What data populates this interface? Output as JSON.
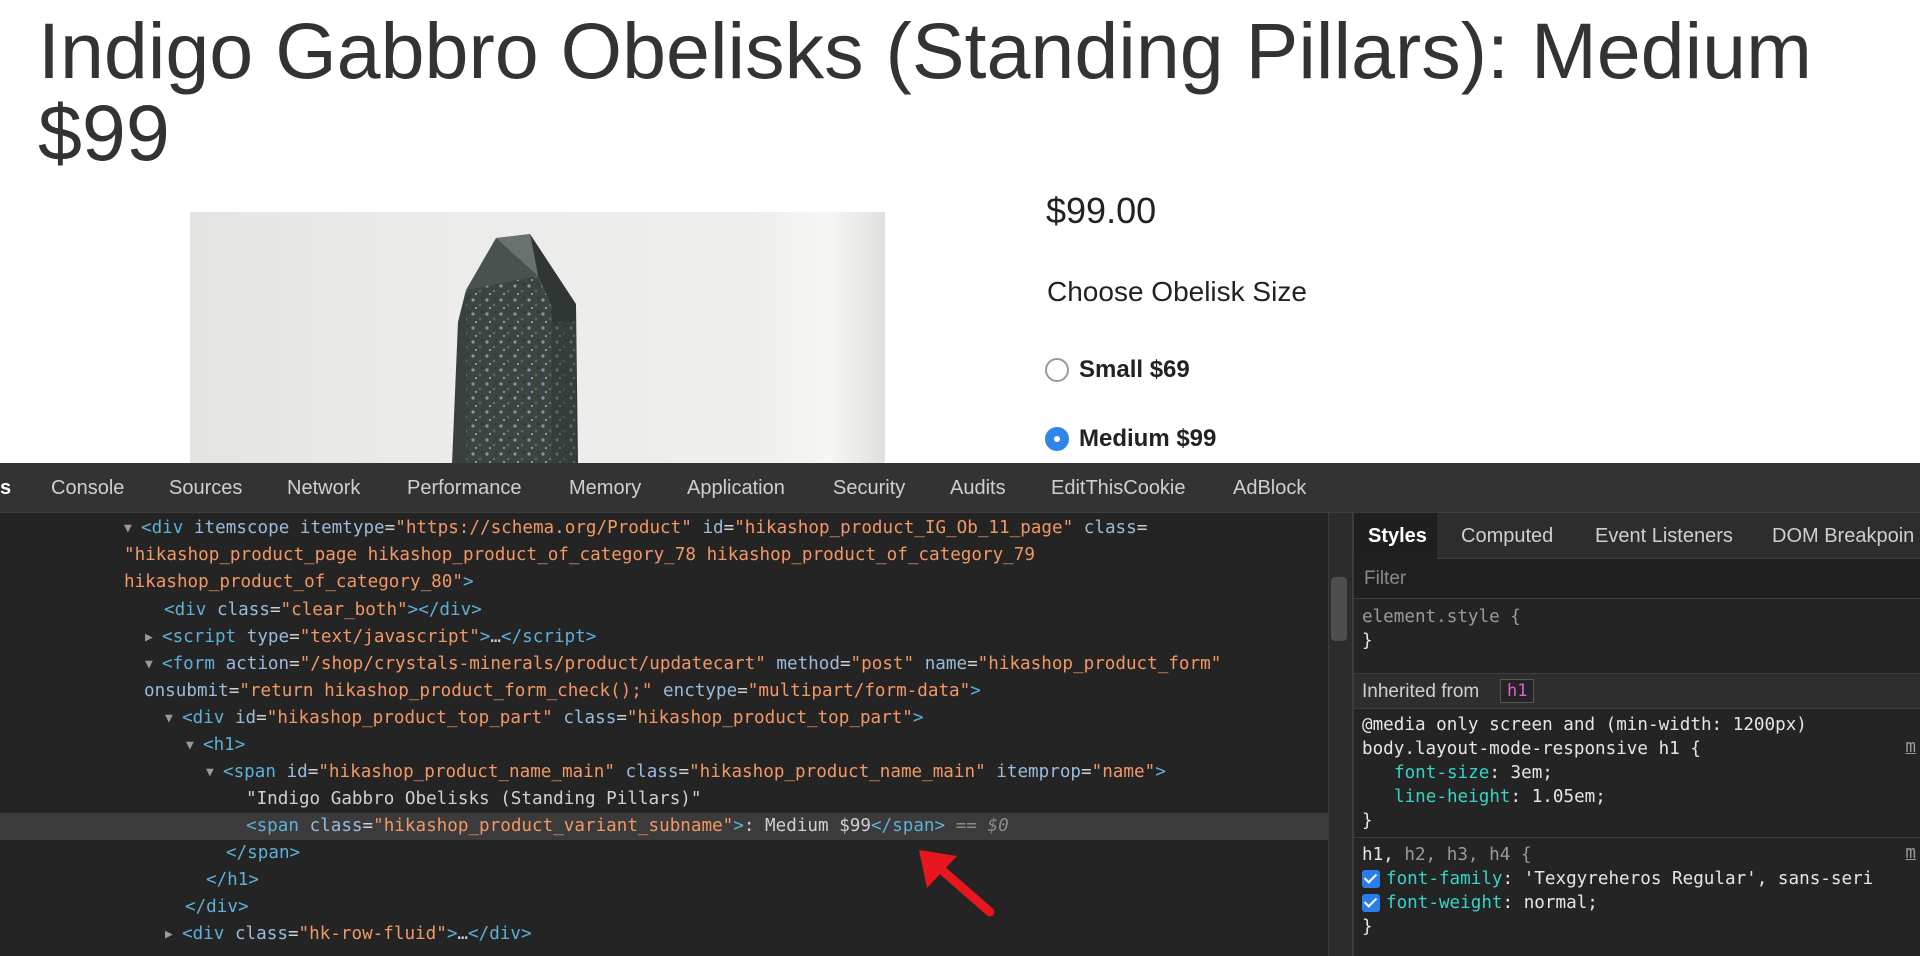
{
  "product": {
    "title": "Indigo Gabbro Obelisks (Standing Pillars): Medium $99",
    "price": "$99.00",
    "option_heading": "Choose Obelisk Size",
    "options": [
      {
        "label": "Small $69",
        "selected": false
      },
      {
        "label": "Medium $99",
        "selected": true
      }
    ]
  },
  "devtools": {
    "tabs": [
      "s",
      "Console",
      "Sources",
      "Network",
      "Performance",
      "Memory",
      "Application",
      "Security",
      "Audits",
      "EditThisCookie",
      "AdBlock"
    ],
    "active_tab": "s",
    "dom": {
      "l1": {
        "tag_open": "<div",
        "a1": "itemscope",
        "a2": "itemtype",
        "v2": "\"https://schema.org/Product\"",
        "a3": "id",
        "v3": "\"hikashop_product_IG_Ob_11_page\"",
        "a4": "class"
      },
      "l2": "\"hikashop_product_page hikashop_product_of_category_78 hikashop_product_of_category_79",
      "l3": "hikashop_product_of_category_80\"",
      "l4": {
        "tag": "div",
        "attr": "class",
        "value": "\"clear_both\""
      },
      "l5": {
        "tag": "script",
        "attr": "type",
        "value": "\"text/javascript\""
      },
      "l6": {
        "tag": "form",
        "a1": "action",
        "v1": "\"/shop/crystals-minerals/product/updatecart\"",
        "a2": "method",
        "v2": "\"post\"",
        "a3": "name",
        "v3": "\"hikashop_product_form\""
      },
      "l7": {
        "a1": "onsubmit",
        "v1": "\"return hikashop_product_form_check();\"",
        "a2": "enctype",
        "v2": "\"multipart/form-data\""
      },
      "l8": {
        "tag": "div",
        "a1": "id",
        "v1": "\"hikashop_product_top_part\"",
        "a2": "class",
        "v2": "\"hikashop_product_top_part\""
      },
      "l9": {
        "tag": "h1"
      },
      "l10": {
        "tag": "span",
        "a1": "id",
        "v1": "\"hikashop_product_name_main\"",
        "a2": "class",
        "v2": "\"hikashop_product_name_main\"",
        "a3": "itemprop",
        "v3": "\"name\""
      },
      "l11": "\"Indigo Gabbro Obelisks (Standing Pillars)\"",
      "l12": {
        "tag": "span",
        "attr": "class",
        "value": "\"hikashop_product_variant_subname\"",
        "text": ": Medium $99",
        "marker": "== $0"
      },
      "l13": "</span>",
      "l14": "</h1>",
      "l15": "</div>",
      "l16": {
        "tag": "div",
        "attr": "class",
        "value": "\"hk-row-fluid\""
      }
    },
    "styles": {
      "tabs": [
        "Styles",
        "Computed",
        "Event Listeners",
        "DOM Breakpoin"
      ],
      "filter_placeholder": "Filter",
      "element_style": "element.style {",
      "close_brace": "}",
      "inherited_label": "Inherited from",
      "inherited_tag": "h1",
      "media_rule": "@media only screen and (min-width: 1200px)",
      "selector1": "body.layout-mode-responsive h1 {",
      "decl1": [
        {
          "prop": "font-size",
          "value": "3em;"
        },
        {
          "prop": "line-height",
          "value": "1.05em;"
        }
      ],
      "selector2_main": "h1,",
      "selector2_rest": " h2, h3, h4 {",
      "decl2": [
        {
          "prop": "font-family",
          "value": "'Texgyreheros Regular', sans-seri"
        },
        {
          "prop": "font-weight",
          "value": "normal;"
        }
      ],
      "src_marker": "m"
    }
  },
  "colors": {
    "devtools_bg": "#242424",
    "tag": "#5db0d7",
    "attr_name": "#9bbbdc",
    "attr_value": "#f29766",
    "css_prop": "#35d4c7",
    "radio_checked": "#2f86e8",
    "annotation_arrow": "#e8161e"
  }
}
